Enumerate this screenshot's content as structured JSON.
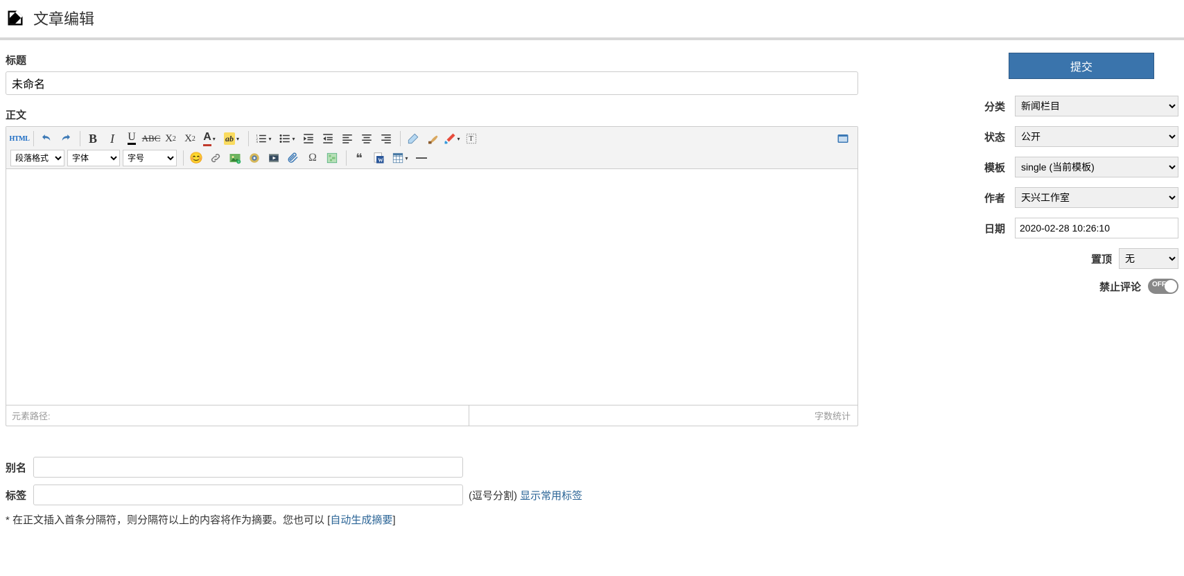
{
  "header": {
    "title": "文章编辑"
  },
  "main": {
    "title_label": "标题",
    "title_value": "未命名",
    "body_label": "正文",
    "editor": {
      "paraformat_placeholder": "段落格式",
      "fontname_placeholder": "字体",
      "fontsize_placeholder": "字号",
      "status_left": "元素路径:",
      "status_right": "字数统计"
    },
    "alias_label": "别名",
    "alias_value": "",
    "tags_label": "标签",
    "tags_value": "",
    "tags_hint_prefix": "(逗号分割) ",
    "tags_hint_link": "显示常用标签",
    "summary_hint_prefix": "* 在正文插入首条分隔符，则分隔符以上的内容将作为摘要。您也可以 [",
    "summary_hint_link": "自动生成摘要",
    "summary_hint_suffix": "]"
  },
  "sidebar": {
    "submit_label": "提交",
    "category": {
      "label": "分类",
      "value": "新闻栏目"
    },
    "status": {
      "label": "状态",
      "value": "公开"
    },
    "template": {
      "label": "模板",
      "value": "single (当前模板)"
    },
    "author": {
      "label": "作者",
      "value": "天兴工作室"
    },
    "date": {
      "label": "日期",
      "value": "2020-02-28 10:26:10"
    },
    "sticky": {
      "label": "置顶",
      "value": "无"
    },
    "disable_comment": {
      "label": "禁止评论",
      "state": "OFF"
    }
  }
}
